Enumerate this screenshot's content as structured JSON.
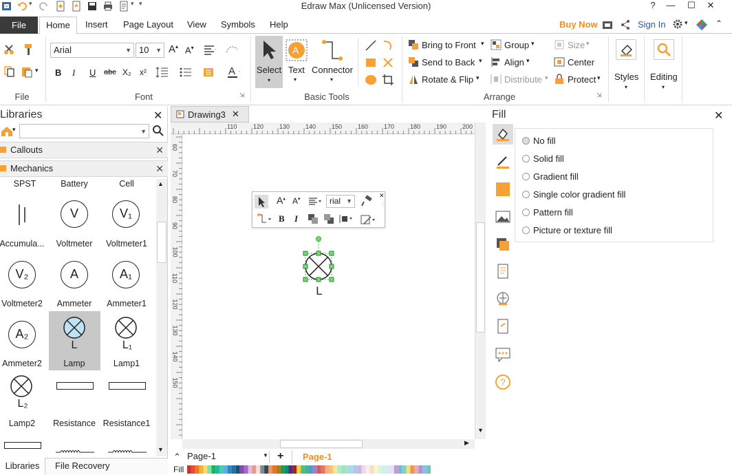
{
  "title": "Edraw Max (Unlicensed Version)",
  "title_right": {
    "buy_now": "Buy Now",
    "sign_in": "Sign In"
  },
  "tabs": [
    "File",
    "Home",
    "Insert",
    "Page Layout",
    "View",
    "Symbols",
    "Help"
  ],
  "ribbon": {
    "file_group": "File",
    "font_group": "Font",
    "font_name": "Arial",
    "font_size": "10",
    "basic_tools_group": "Basic Tools",
    "select": "Select",
    "text": "Text",
    "connector": "Connector",
    "arrange_group": "Arrange",
    "bring_to_front": "Bring to Front",
    "send_to_back": "Send to Back",
    "rotate_flip": "Rotate & Flip",
    "group": "Group",
    "align": "Align",
    "distribute": "Distribute",
    "size": "Size",
    "center": "Center",
    "protect": "Protect",
    "styles": "Styles",
    "editing": "Editing",
    "bold": "B",
    "italic": "I",
    "underline": "U",
    "strike": "abc",
    "subscript": "X₂",
    "superscript": "x²"
  },
  "libraries": {
    "title": "Libraries",
    "sections": [
      "Callouts",
      "Mechanics"
    ],
    "symbols": [
      {
        "label": "SPST"
      },
      {
        "label": "Battery"
      },
      {
        "label": "Cell"
      },
      {
        "label": "Accumula..."
      },
      {
        "label": "Voltmeter"
      },
      {
        "label": "Voltmeter1"
      },
      {
        "label": "Voltmeter2"
      },
      {
        "label": "Ammeter"
      },
      {
        "label": "Ammeter1"
      },
      {
        "label": "Ammeter2"
      },
      {
        "label": "Lamp"
      },
      {
        "label": "Lamp1"
      },
      {
        "label": "Lamp2"
      },
      {
        "label": "Resistance"
      },
      {
        "label": "Resistance1"
      }
    ],
    "glyphs": {
      "V": "V",
      "V1": "V₁",
      "V2": "V₂",
      "A": "A",
      "A1": "A₁",
      "A2": "A₂",
      "L": "L",
      "L1": "L₁",
      "L2": "L₂"
    },
    "bottom_tabs": [
      "Libraries",
      "File Recovery"
    ]
  },
  "document": {
    "tab": "Drawing3",
    "ruler_top": [
      "110",
      "120",
      "130",
      "140",
      "150",
      "160",
      "170",
      "180",
      "190",
      "200"
    ],
    "ruler_left": [
      "60",
      "70",
      "80",
      "90",
      "100",
      "110",
      "120",
      "130",
      "140",
      "150"
    ],
    "shape_label": "L",
    "mini_font": "rial",
    "page_select": "Page-1",
    "page_tab": "Page-1",
    "fill_label": "Fill"
  },
  "fill_panel": {
    "title": "Fill",
    "options": [
      "No fill",
      "Solid fill",
      "Gradient fill",
      "Single color gradient fill",
      "Pattern fill",
      "Picture or texture fill"
    ],
    "selected": "No fill"
  },
  "colors": {
    "accent_orange": "#f7a135",
    "file_tab": "#3a3a3a",
    "buy_now": "#f58c1f",
    "sign_in": "#1a5fb4",
    "selection": "#3db03d",
    "palette": [
      "#c0392b",
      "#e74c3c",
      "#e67e22",
      "#f5b041",
      "#f7dc6f",
      "#82e0aa",
      "#27ae60",
      "#1abc9c",
      "#48c9b0",
      "#5dade2",
      "#2e86c1",
      "#2471a3",
      "#1a5276",
      "#8e44ad",
      "#a569bd",
      "#d7bde2",
      "#f1948a",
      "#fadbd8",
      "#7f8c8d",
      "#34495e",
      "#e59866",
      "#dc7633",
      "#b9770e",
      "#229954",
      "#138d75",
      "#5b2c6f",
      "#922b21",
      "#f4d03f",
      "#52be80",
      "#45b39d",
      "#5499c7",
      "#af7ac5",
      "#cd6155",
      "#ec7063",
      "#f0b27a",
      "#f8c471",
      "#f9e79f",
      "#abebc6",
      "#a9dfbf",
      "#a3e4d7",
      "#aed6f1",
      "#a9cce3",
      "#d2b4de",
      "#e8daef",
      "#fdedec",
      "#f6ddcc",
      "#fcf3cf",
      "#d5f5e3",
      "#d1f2eb",
      "#d6eaf8",
      "#ebdef0",
      "#c39bd3",
      "#7fb3d5",
      "#76d7c4",
      "#f7dc6f",
      "#eb984e",
      "#e6b0aa",
      "#bb8fce",
      "#85c1e9",
      "#73c6b6"
    ]
  }
}
